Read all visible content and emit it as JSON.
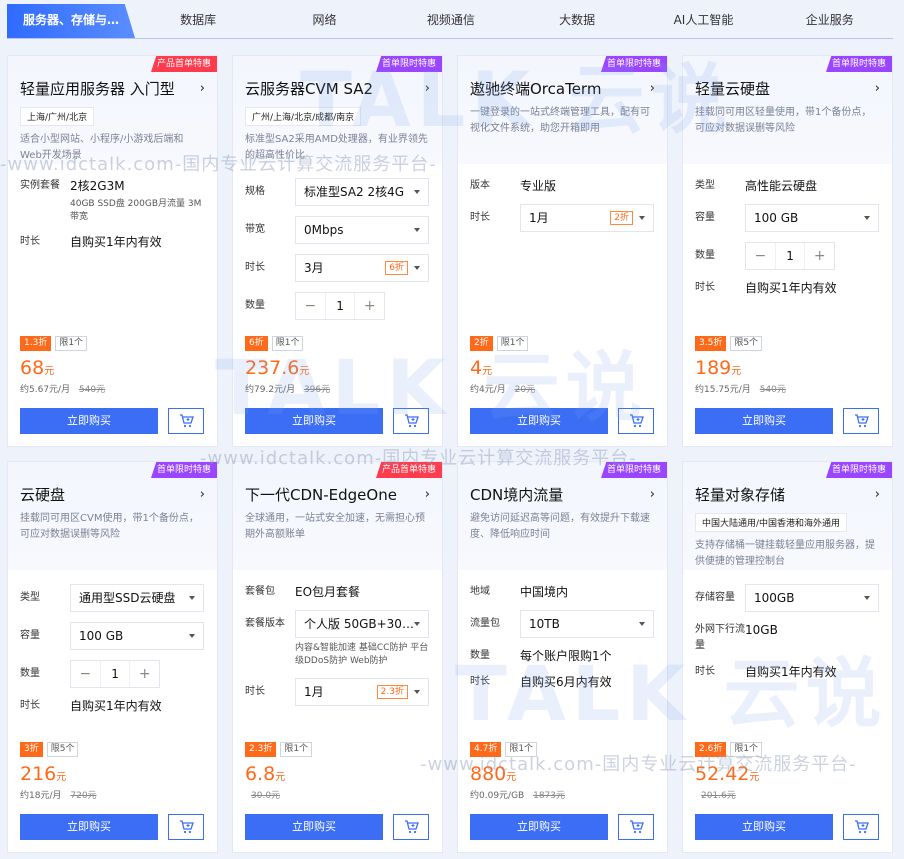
{
  "tabs": [
    "服务器、存储与…",
    "数据库",
    "网络",
    "视频通信",
    "大数据",
    "AI人工智能",
    "企业服务"
  ],
  "cards": [
    {
      "badge": "产品首单特惠",
      "badge_color": "#ff3b4e",
      "title": "轻量应用服务器 入门型",
      "region": "上海/广州/北京",
      "desc": "适合小型网站、小程序/小游戏后端和Web开发场景",
      "rows": [
        {
          "label": "实例套餐",
          "value": "2核2G3M",
          "sub": "40GB SSD盘 200GB月流量 3M带宽"
        },
        {
          "label": "时长",
          "value": "自购买1年内有效"
        }
      ],
      "discount": "1.3折",
      "limit": "限1个",
      "price": "68",
      "unit": "元",
      "per": "约5.67元/月",
      "orig": "540元",
      "buy": "立即购买"
    },
    {
      "badge": "首单限时特惠",
      "badge_color": "#9a45ff",
      "title": "云服务器CVM SA2",
      "region": "广州/上海/北京/成都/南京",
      "desc": "标准型SA2采用AMD处理器，有业界领先的超高性价比",
      "rows": [
        {
          "label": "规格",
          "select": "标准型SA2 2核4G"
        },
        {
          "label": "带宽",
          "select": "0Mbps"
        },
        {
          "label": "时长",
          "select": "3月",
          "select_disc": "6折"
        },
        {
          "label": "数量",
          "stepper": "1"
        }
      ],
      "discount": "6折",
      "limit": "限1个",
      "price": "237.6",
      "unit": "元",
      "per": "约79.2元/月",
      "orig": "396元",
      "buy": "立即购买"
    },
    {
      "badge": "首单限时特惠",
      "badge_color": "#9a45ff",
      "title": "遨驰终端OrcaTerm",
      "region": "",
      "desc": "一键登录的一站式终端管理工具，配有可视化文件系统，助您开箱即用",
      "rows": [
        {
          "label": "版本",
          "value": "专业版"
        },
        {
          "label": "时长",
          "select": "1月",
          "select_disc": "2折"
        }
      ],
      "discount": "2折",
      "limit": "限1个",
      "price": "4",
      "unit": "元",
      "per": "约4元/月",
      "orig": "20元",
      "buy": "立即购买"
    },
    {
      "badge": "首单限时特惠",
      "badge_color": "#9a45ff",
      "title": "轻量云硬盘",
      "region": "",
      "desc": "挂载同可用区轻量使用，带1个备份点，可应对数据误删等风险",
      "rows": [
        {
          "label": "类型",
          "value": "高性能云硬盘"
        },
        {
          "label": "容量",
          "select": "100 GB"
        },
        {
          "label": "数量",
          "stepper": "1"
        },
        {
          "label": "时长",
          "value": "自购买1年内有效"
        }
      ],
      "discount": "3.5折",
      "limit": "限5个",
      "price": "189",
      "unit": "元",
      "per": "约15.75元/月",
      "orig": "540元",
      "buy": "立即购买"
    },
    {
      "badge": "首单限时特惠",
      "badge_color": "#9a45ff",
      "title": "云硬盘",
      "region": "",
      "desc": "挂载同可用区CVM使用，带1个备份点，可应对数据误删等风险",
      "rows": [
        {
          "label": "类型",
          "select": "通用型SSD云硬盘"
        },
        {
          "label": "容量",
          "select": "100 GB"
        },
        {
          "label": "数量",
          "stepper": "1"
        },
        {
          "label": "时长",
          "value": "自购买1年内有效"
        }
      ],
      "discount": "3折",
      "limit": "限5个",
      "price": "216",
      "unit": "元",
      "per": "约18元/月",
      "orig": "720元",
      "buy": "立即购买"
    },
    {
      "badge": "产品首单特惠",
      "badge_color": "#ff3b4e",
      "title": "下一代CDN-EdgeOne",
      "region": "",
      "desc": "全球通用，一站式安全加速，无需担心预期外高额账单",
      "rows": [
        {
          "label": "套餐包",
          "value": "EO包月套餐"
        },
        {
          "label": "套餐版本",
          "select": "个人版 50GB+30…",
          "sub": "内容&智能加速 基础CC防护 平台级DDoS防护 Web防护"
        },
        {
          "label": "时长",
          "select": "1月",
          "select_disc": "2.3折"
        }
      ],
      "discount": "2.3折",
      "limit": "限1个",
      "price": "6.8",
      "unit": "元",
      "per": "",
      "orig": "30.0元",
      "buy": "立即购买"
    },
    {
      "badge": "首单限时特惠",
      "badge_color": "#9a45ff",
      "title": "CDN境内流量",
      "region": "",
      "desc": "避免访问延迟高等问题，有效提升下载速度、降低响应时间",
      "rows": [
        {
          "label": "地域",
          "value": "中国境内"
        },
        {
          "label": "流量包",
          "select": "10TB"
        },
        {
          "label": "数量",
          "value": "每个账户限购1个"
        },
        {
          "label": "时长",
          "value": "自购买6月内有效"
        }
      ],
      "discount": "4.7折",
      "limit": "限1个",
      "price": "880",
      "unit": "元",
      "per": "约0.09元/GB",
      "orig": "1873元",
      "buy": "立即购买"
    },
    {
      "badge": "首单限时特惠",
      "badge_color": "#9a45ff",
      "title": "轻量对象存储",
      "region": "中国大陆通用/中国香港和海外通用",
      "desc": "支持存储桶一键挂载轻量应用服务器，提供便捷的管理控制台",
      "rows": [
        {
          "label": "存储容量",
          "select": "100GB"
        },
        {
          "label": "外网下行流量",
          "value": "10GB"
        },
        {
          "label": "时长",
          "value": "自购买1年内有效"
        }
      ],
      "discount": "2.6折",
      "limit": "限1个",
      "price": "52.42",
      "unit": "元",
      "per": "",
      "orig": "201.6元",
      "buy": "立即购买"
    }
  ],
  "watermark": {
    "text": "-www.idctalk.com-国内专业云计算交流服务平台-",
    "logo": "TALK 云说"
  }
}
